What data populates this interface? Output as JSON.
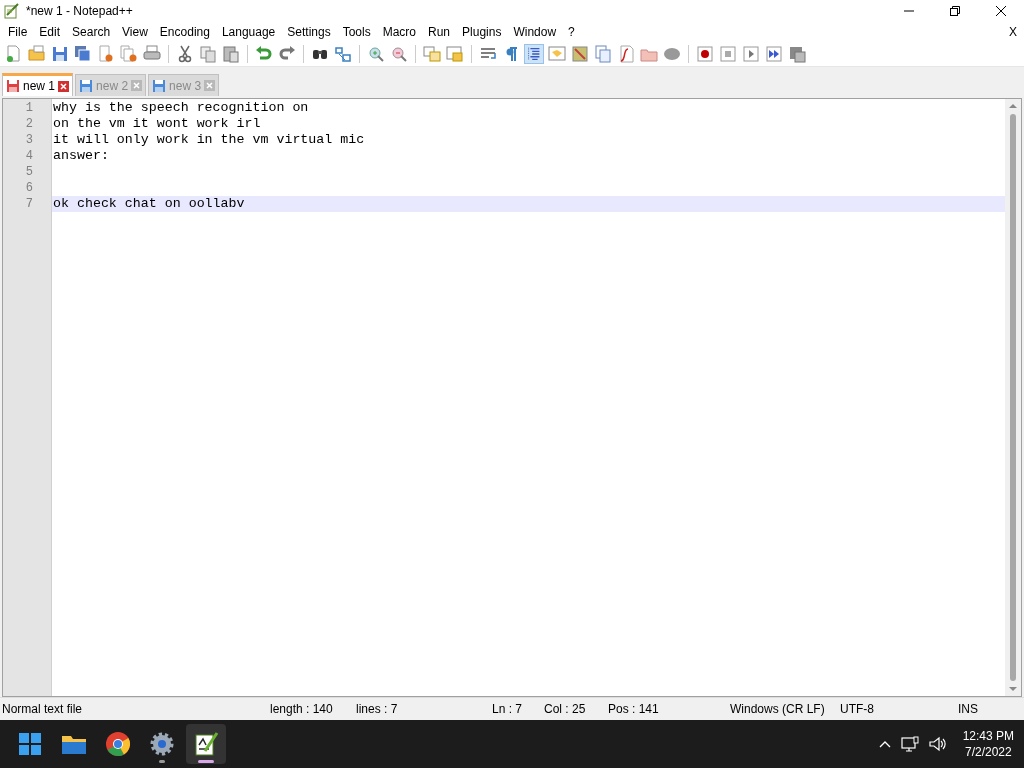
{
  "window": {
    "title": "*new 1 - Notepad++"
  },
  "menu": [
    "File",
    "Edit",
    "Search",
    "View",
    "Encoding",
    "Language",
    "Settings",
    "Tools",
    "Macro",
    "Run",
    "Plugins",
    "Window",
    "?"
  ],
  "menu_close": "X",
  "tabs": [
    {
      "label": "new 1",
      "selected": true,
      "modified": true
    },
    {
      "label": "new 2",
      "selected": false,
      "modified": false
    },
    {
      "label": "new 3",
      "selected": false,
      "modified": false
    }
  ],
  "editor": {
    "lines": [
      {
        "number": "1",
        "text": "why is the speech recognition on",
        "current": false
      },
      {
        "number": "2",
        "text": "on the vm it wont work irl",
        "current": false
      },
      {
        "number": "3",
        "text": "it will only work in the vm virtual mic",
        "current": false
      },
      {
        "number": "4",
        "text": "answer:",
        "current": false
      },
      {
        "number": "5",
        "current": false
      },
      {
        "number": "6",
        "current": false
      },
      {
        "number": "7",
        "text": "ok check chat on oollabv",
        "current": true
      }
    ]
  },
  "status_bar": {
    "file_type": "Normal text file",
    "length": "length : 140",
    "lines": "lines : 7",
    "ln": "Ln : 7",
    "col": "Col : 25",
    "pos": "Pos : 141",
    "eol": "Windows (CR LF)",
    "encoding": "UTF-8",
    "mode": "INS"
  },
  "taskbar": {
    "apps": [
      {
        "kind": "start",
        "active": false,
        "running": false
      },
      {
        "kind": "folder",
        "active": false,
        "running": false
      },
      {
        "kind": "browser",
        "active": false,
        "running": false
      },
      {
        "kind": "settings",
        "active": false,
        "running": true
      },
      {
        "kind": "notepad",
        "active": true,
        "running": true
      }
    ],
    "time": "12:43 PM",
    "date": "7/2/2022"
  }
}
